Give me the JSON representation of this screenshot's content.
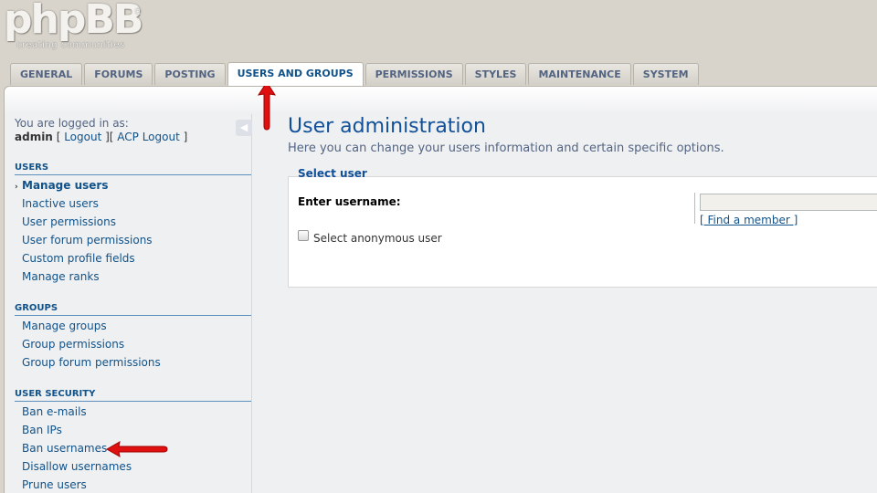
{
  "logo": {
    "name": "phpBB",
    "registered": "®",
    "tagline": "creating   communities"
  },
  "tabs": [
    {
      "label": "GENERAL"
    },
    {
      "label": "FORUMS"
    },
    {
      "label": "POSTING"
    },
    {
      "label": "USERS AND GROUPS",
      "active": true
    },
    {
      "label": "PERMISSIONS"
    },
    {
      "label": "STYLES"
    },
    {
      "label": "MAINTENANCE"
    },
    {
      "label": "SYSTEM"
    }
  ],
  "login": {
    "text": "You are logged in as:",
    "username": "admin",
    "logout": "Logout",
    "acp_logout": "ACP Logout"
  },
  "sidebar": {
    "collapse_icon": "triangle-left-icon",
    "sections": [
      {
        "title": "USERS",
        "items": [
          "Manage users",
          "Inactive users",
          "User permissions",
          "User forum permissions",
          "Custom profile fields",
          "Manage ranks"
        ]
      },
      {
        "title": "GROUPS",
        "items": [
          "Manage groups",
          "Group permissions",
          "Group forum permissions"
        ]
      },
      {
        "title": "USER SECURITY",
        "items": [
          "Ban e-mails",
          "Ban IPs",
          "Ban usernames",
          "Disallow usernames",
          "Prune users"
        ]
      }
    ],
    "active_item": "Manage users"
  },
  "main": {
    "title": "User administration",
    "description": "Here you can change your users information and certain specific options.",
    "fieldset_legend": "Select user",
    "username_label": "Enter username:",
    "username_value": "",
    "find_member": "[ Find a member ]",
    "anonymous_label": "Select anonymous user",
    "anonymous_checked": false
  },
  "colors": {
    "accent": "#105289",
    "annotation_arrow": "#e01010",
    "background": "#d8d4cb"
  }
}
